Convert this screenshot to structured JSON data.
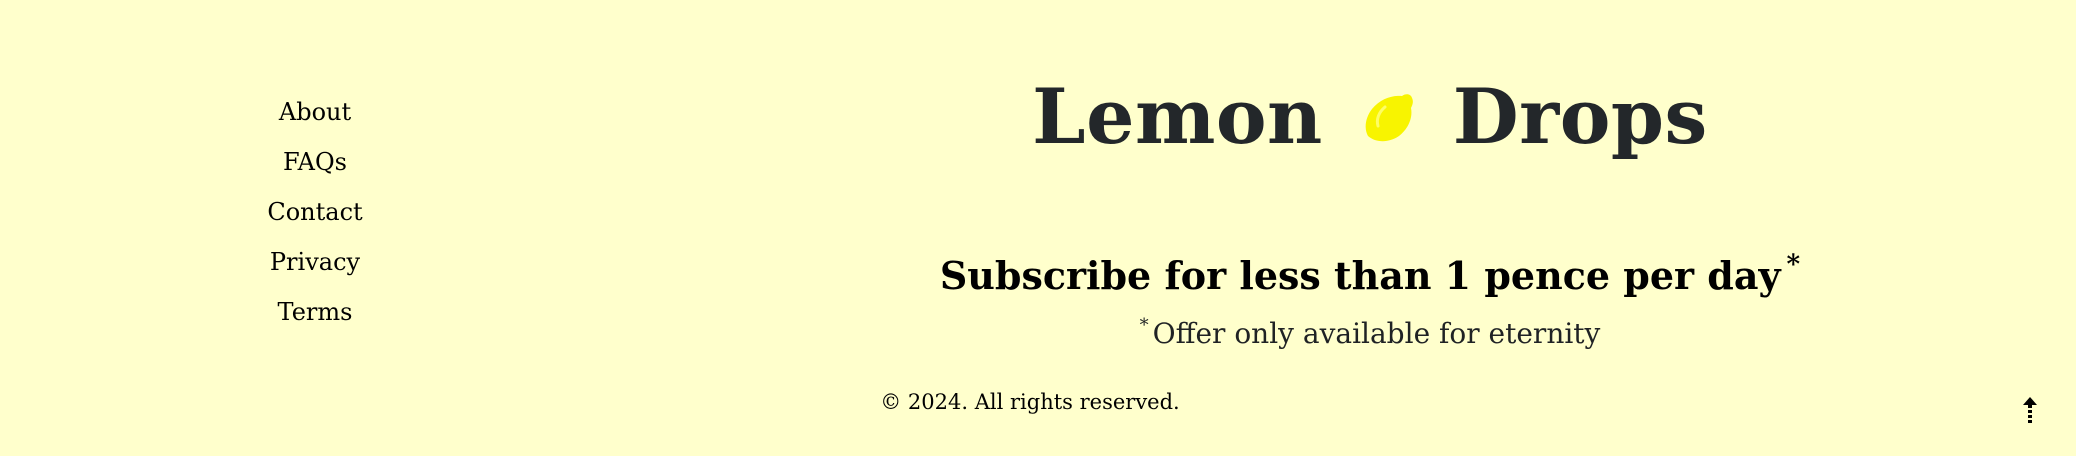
{
  "nav": {
    "items": [
      {
        "label": "About"
      },
      {
        "label": "FAQs"
      },
      {
        "label": "Contact"
      },
      {
        "label": "Privacy"
      },
      {
        "label": "Terms"
      }
    ]
  },
  "brand": {
    "word1": "Lemon",
    "word2": "Drops",
    "icon": "lemon-icon",
    "icon_color": "#f8f400"
  },
  "promo": {
    "subscribe_text": "Subscribe for less than 1 pence per day",
    "asterisk": "*",
    "offer_text": "Offer only available for eternity"
  },
  "footer": {
    "copyright": "© 2024. All rights reserved.",
    "back_to_top_icon": "arrow-up-icon"
  },
  "colors": {
    "background": "#ffffcc",
    "text": "#23272a",
    "lemon": "#f8f400"
  }
}
